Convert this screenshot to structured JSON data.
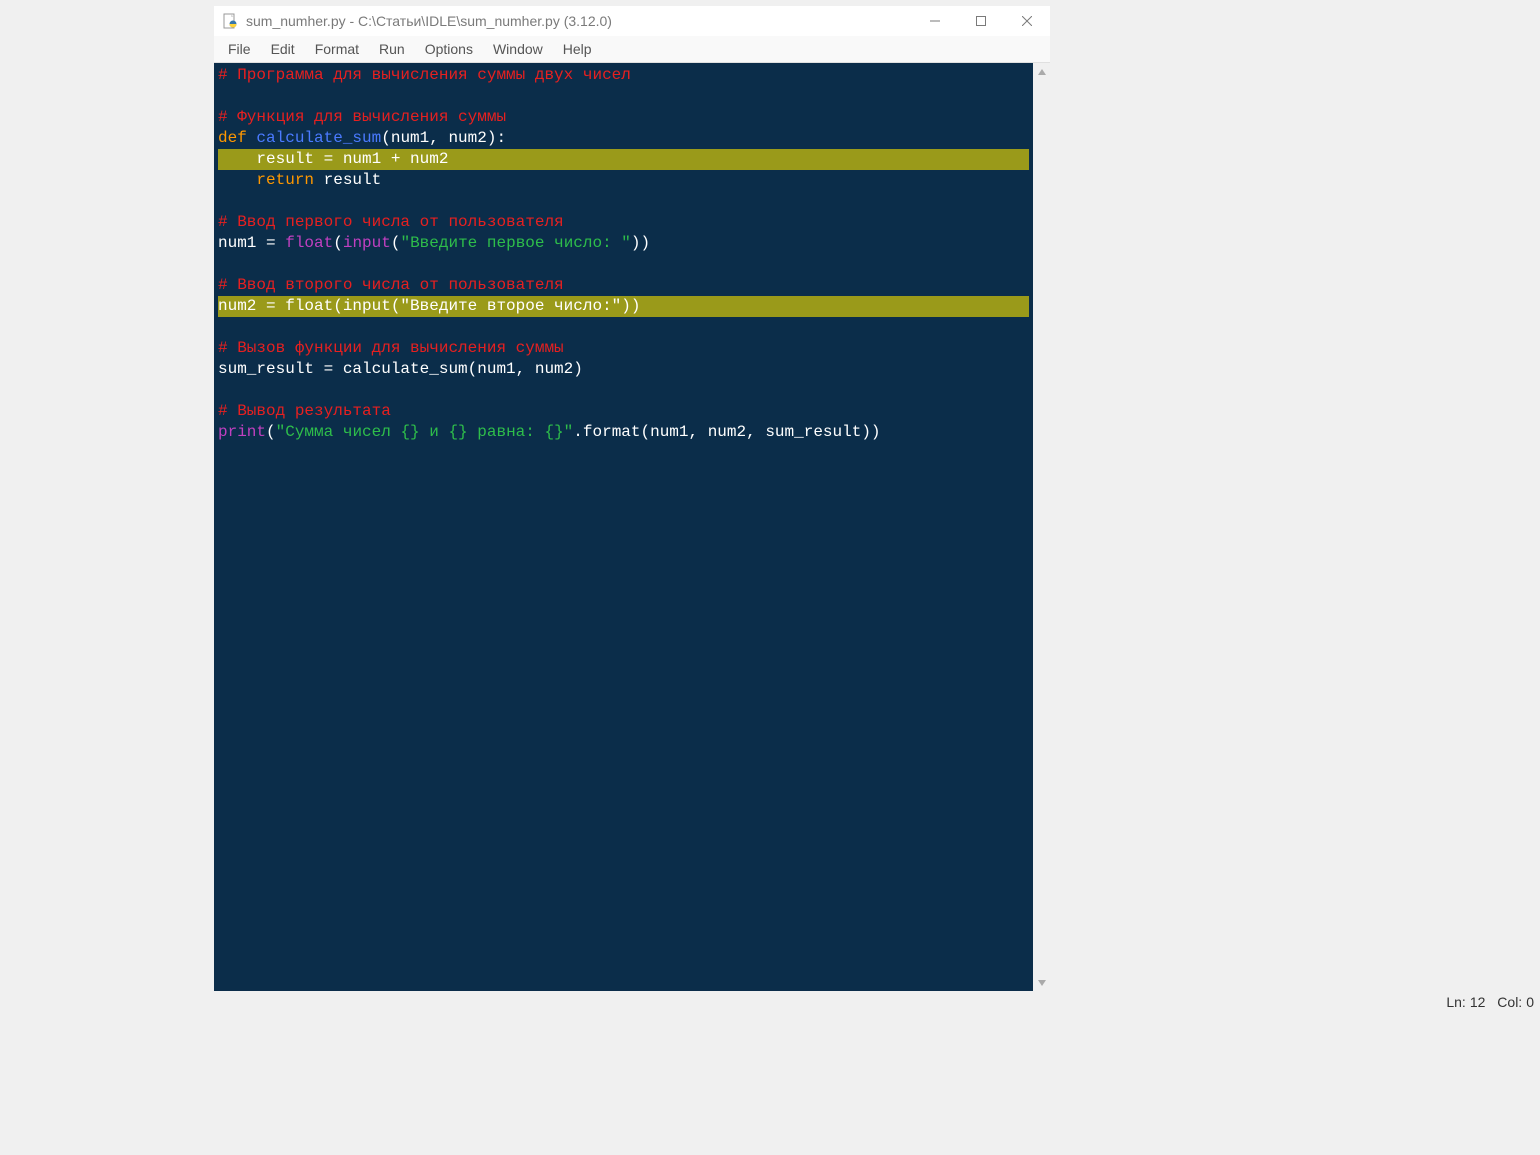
{
  "titlebar": {
    "title": "sum_numher.py - C:\\Статьи\\IDLE\\sum_numher.py (3.12.0)"
  },
  "menu": {
    "file": "File",
    "edit": "Edit",
    "format": "Format",
    "run": "Run",
    "options": "Options",
    "window": "Window",
    "help": "Help"
  },
  "code": {
    "l1_comment": "# Программа для вычисления суммы двух чисел",
    "l3_comment": "# Функция для вычисления суммы",
    "l4_def": "def",
    "l4_name": " calculate_sum",
    "l4_rest": "(num1, num2):",
    "l5_indent": "    ",
    "l5_text": "result = num1 + num2",
    "l6_indent": "    ",
    "l6_return": "return",
    "l6_rest": " result",
    "l8_comment": "# Ввод первого числа от пользователя",
    "l9_a": "num1 = ",
    "l9_float": "float",
    "l9_p1": "(",
    "l9_input": "input",
    "l9_p2": "(",
    "l9_str": "\"Введите первое число: \"",
    "l9_p3": "))",
    "l11_comment": "# Ввод второго числа от пользователя",
    "l12_text": "num2 = float(input(\"Введите второе число:\"))",
    "l14_comment": "# Вызов функции для вычисления суммы",
    "l15_text": "sum_result = calculate_sum(num1, num2)",
    "l17_comment": "# Вывод результата",
    "l18_print": "print",
    "l18_p1": "(",
    "l18_str": "\"Сумма чисел {} и {} равна: {}\"",
    "l18_rest": ".format(num1, num2, sum_result))"
  },
  "status": {
    "ln_label": "Ln:",
    "ln_val": "12",
    "col_label": "Col:",
    "col_val": "0"
  }
}
